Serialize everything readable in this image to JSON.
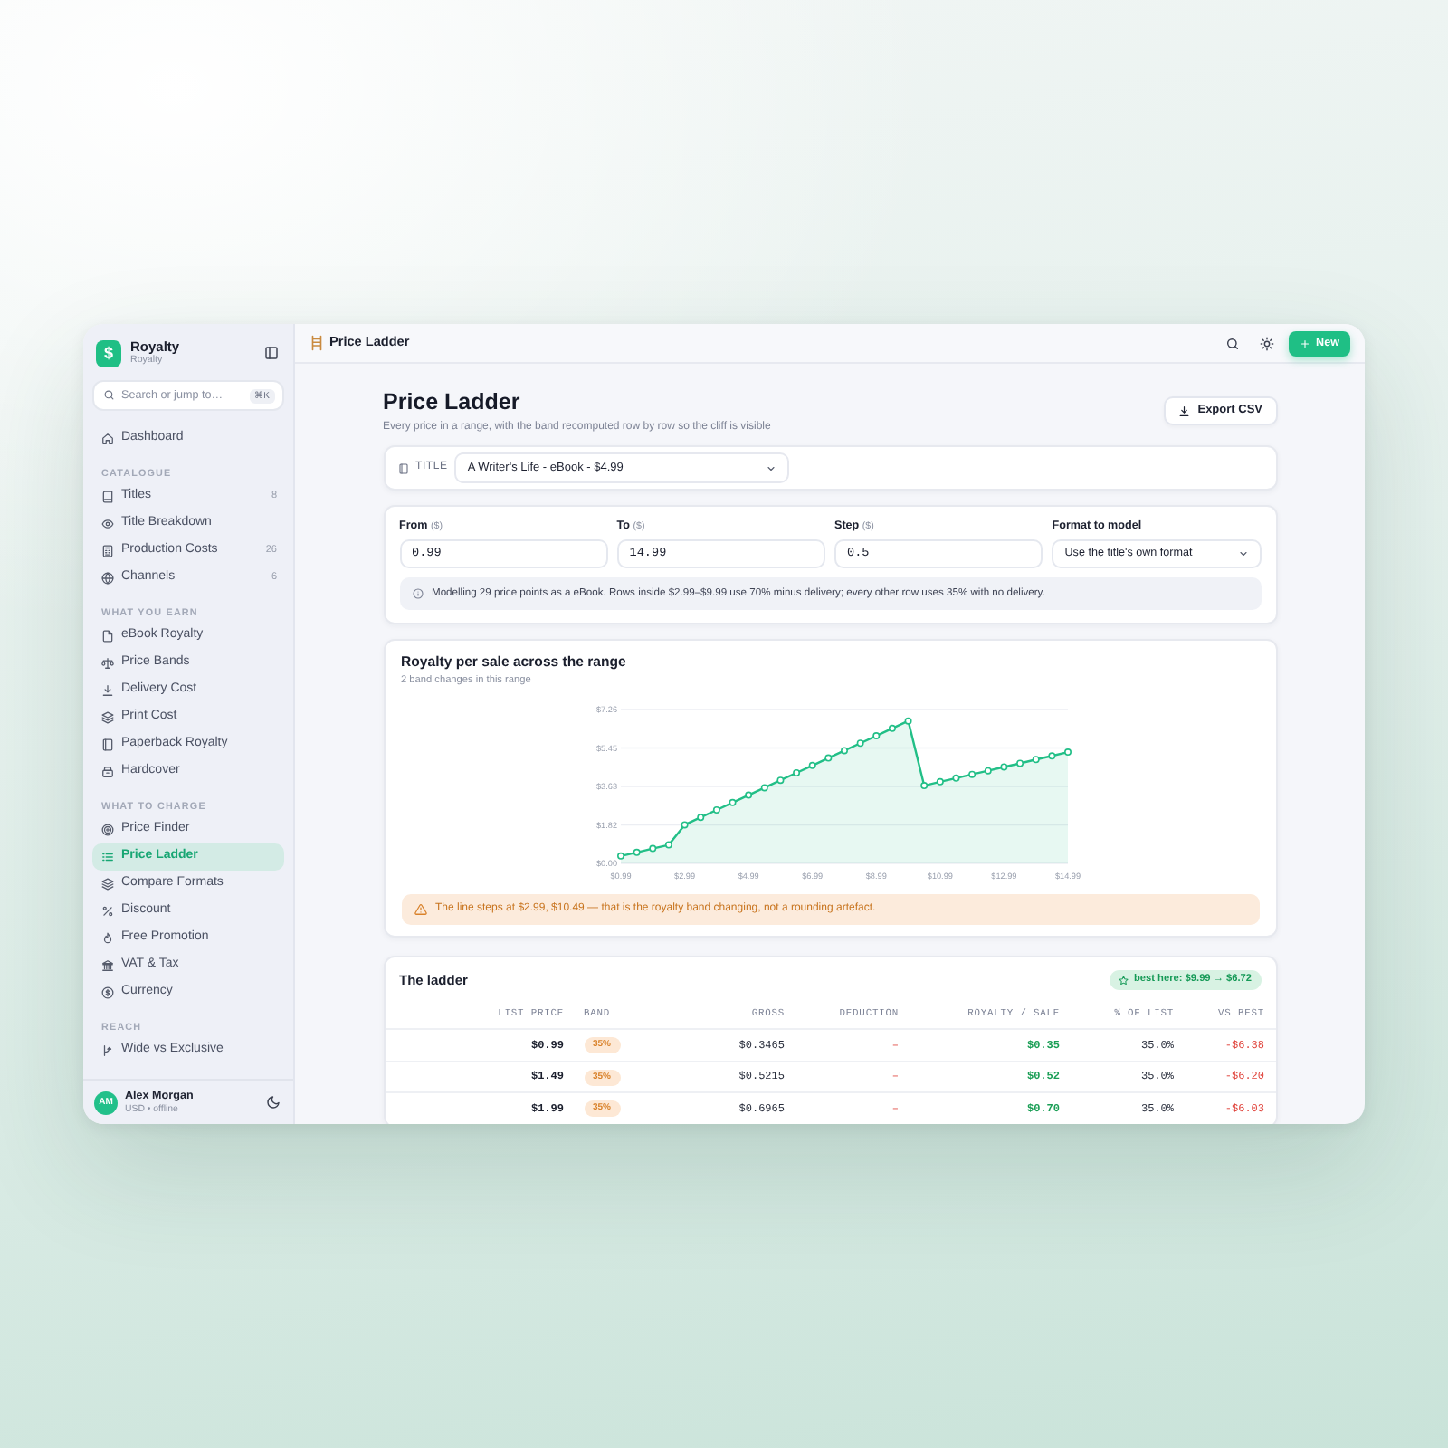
{
  "sidebar": {
    "brand": {
      "logo": "$",
      "name": "Royalty",
      "subtitle": "Royalty"
    },
    "search": {
      "placeholder": "Search or jump to…",
      "shortcut": "⌘K"
    },
    "nav": [
      {
        "items": [
          {
            "label": "Dashboard",
            "selected": false
          }
        ]
      },
      {
        "heading": "CATALOGUE",
        "items": [
          {
            "label": "Titles",
            "count": "8",
            "selected": false
          },
          {
            "label": "Title Breakdown",
            "selected": false
          },
          {
            "label": "Production Costs",
            "count": "26",
            "selected": false
          },
          {
            "label": "Channels",
            "count": "6",
            "selected": false
          }
        ]
      },
      {
        "heading": "WHAT YOU EARN",
        "items": [
          {
            "label": "eBook Royalty",
            "selected": false
          },
          {
            "label": "Price Bands",
            "selected": false
          },
          {
            "label": "Delivery Cost",
            "selected": false
          },
          {
            "label": "Print Cost",
            "selected": false
          },
          {
            "label": "Paperback Royalty",
            "selected": false
          },
          {
            "label": "Hardcover",
            "selected": false
          }
        ]
      },
      {
        "heading": "WHAT TO CHARGE",
        "items": [
          {
            "label": "Price Finder",
            "selected": false
          },
          {
            "label": "Price Ladder",
            "selected": true
          },
          {
            "label": "Compare Formats",
            "selected": false
          },
          {
            "label": "Discount",
            "selected": false
          },
          {
            "label": "Free Promotion",
            "selected": false
          },
          {
            "label": "VAT & Tax",
            "selected": false
          },
          {
            "label": "Currency",
            "selected": false
          }
        ]
      },
      {
        "heading": "REACH",
        "items": [
          {
            "label": "Wide vs Exclusive",
            "selected": false
          }
        ]
      }
    ],
    "user": {
      "initials": "AM",
      "name": "Alex Morgan",
      "status": "USD • offline"
    }
  },
  "topbar": {
    "title": "Price Ladder",
    "new_button": "New"
  },
  "page": {
    "title": "Price Ladder",
    "subtitle": "Every price in a range, with the band recomputed row by row so the cliff is visible",
    "export_button": "Export CSV"
  },
  "title_picker": {
    "label": "TITLE",
    "value": "A Writer's Life - eBook - $4.99"
  },
  "parameters": {
    "fields": [
      {
        "kind": "number",
        "label": "From",
        "unit": "($)",
        "value": "0.99"
      },
      {
        "kind": "number",
        "label": "To",
        "unit": "($)",
        "value": "14.99"
      },
      {
        "kind": "number",
        "label": "Step",
        "unit": "($)",
        "value": "0.5"
      },
      {
        "kind": "select",
        "label": "Format to model",
        "value": "Use the title's own format"
      }
    ],
    "note": "Modelling 29 price points as a eBook. Rows inside $2.99–$9.99 use 70% minus delivery; every other row uses 35% with no delivery."
  },
  "chart_card": {
    "title": "Royalty per sale across the range",
    "subtitle": "2 band changes in this range",
    "chart_data": {
      "type": "area",
      "x": [
        0.99,
        1.49,
        1.99,
        2.49,
        2.99,
        3.49,
        3.99,
        4.49,
        4.99,
        5.49,
        5.99,
        6.49,
        6.99,
        7.49,
        7.99,
        8.49,
        8.99,
        9.49,
        9.99,
        10.49,
        10.99,
        11.49,
        11.99,
        12.49,
        12.99,
        13.49,
        13.99,
        14.49,
        14.99
      ],
      "series": [
        {
          "color": "#22bf87",
          "values": [
            0.35,
            0.52,
            0.7,
            0.87,
            1.82,
            2.17,
            2.52,
            2.87,
            3.22,
            3.57,
            3.92,
            4.27,
            4.62,
            4.97,
            5.32,
            5.67,
            6.02,
            6.37,
            6.72,
            3.67,
            3.85,
            4.02,
            4.2,
            4.37,
            4.55,
            4.72,
            4.9,
            5.07,
            5.25
          ]
        }
      ],
      "xlim": [
        0.99,
        14.99
      ],
      "ylim": [
        0,
        7.26
      ],
      "xticks": [
        {
          "value": 0.99,
          "label": "$0.99"
        },
        {
          "value": 2.99,
          "label": "$2.99"
        },
        {
          "value": 4.99,
          "label": "$4.99"
        },
        {
          "value": 6.99,
          "label": "$6.99"
        },
        {
          "value": 8.99,
          "label": "$8.99"
        },
        {
          "value": 10.99,
          "label": "$10.99"
        },
        {
          "value": 12.99,
          "label": "$12.99"
        },
        {
          "value": 14.99,
          "label": "$14.99"
        }
      ],
      "yticks": [
        {
          "value": 0,
          "label": "$0.00"
        },
        {
          "value": 1.815,
          "label": "$1.82"
        },
        {
          "value": 3.63,
          "label": "$3.63"
        },
        {
          "value": 5.445,
          "label": "$5.45"
        },
        {
          "value": 7.26,
          "label": "$7.26"
        }
      ],
      "grid": true
    },
    "warning": "The line steps at $2.99, $10.49 — that is the royalty band changing, not a rounding artefact."
  },
  "ladder": {
    "title": "The ladder",
    "best": "best here: $9.99 → $6.72",
    "columns": [
      "LIST PRICE",
      "BAND",
      "GROSS",
      "DEDUCTION",
      "ROYALTY / SALE",
      "% OF LIST",
      "VS BEST"
    ],
    "rows": [
      [
        "$0.99",
        "35%",
        "$0.3465",
        "–",
        "$0.35",
        "35.0%",
        "-$6.38"
      ],
      [
        "$1.49",
        "35%",
        "$0.5215",
        "–",
        "$0.52",
        "35.0%",
        "-$6.20"
      ],
      [
        "$1.99",
        "35%",
        "$0.6965",
        "–",
        "$0.70",
        "35.0%",
        "-$6.03"
      ]
    ]
  }
}
